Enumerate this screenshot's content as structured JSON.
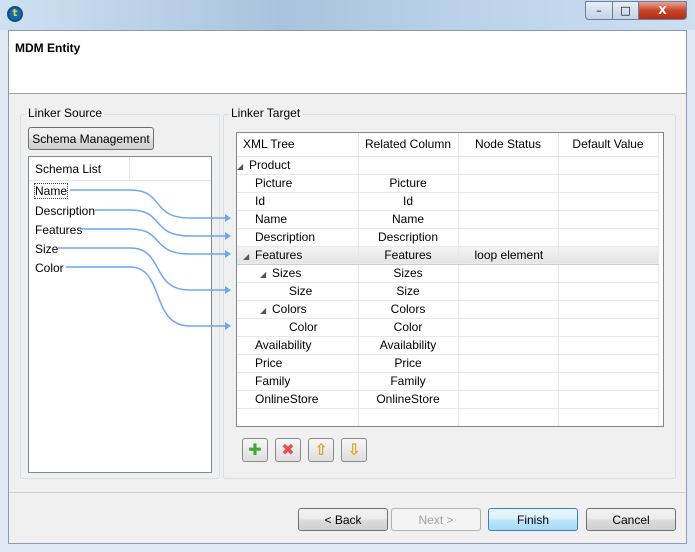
{
  "window": {
    "title": "MDM Entity",
    "controls": {
      "minimize": "–",
      "maximize": "□",
      "close": "X"
    }
  },
  "source": {
    "group_label": "Linker Source",
    "schema_button": "Schema Management",
    "list_header": "Schema List",
    "items": [
      "Name",
      "Description",
      "Features",
      "Size",
      "Color"
    ]
  },
  "target": {
    "group_label": "Linker Target",
    "columns": [
      "XML Tree",
      "Related Column",
      "Node Status",
      "Default Value"
    ],
    "rows": [
      {
        "tree": "Product",
        "related": "",
        "status": "",
        "default": ""
      },
      {
        "tree": "Picture",
        "related": "Picture",
        "status": "",
        "default": ""
      },
      {
        "tree": "Id",
        "related": "Id",
        "status": "",
        "default": ""
      },
      {
        "tree": "Name",
        "related": "Name",
        "status": "",
        "default": ""
      },
      {
        "tree": "Description",
        "related": "Description",
        "status": "",
        "default": ""
      },
      {
        "tree": "Features",
        "related": "Features",
        "status": "loop element",
        "default": ""
      },
      {
        "tree": "Sizes",
        "related": "Sizes",
        "status": "",
        "default": ""
      },
      {
        "tree": "Size",
        "related": "Size",
        "status": "",
        "default": ""
      },
      {
        "tree": "Colors",
        "related": "Colors",
        "status": "",
        "default": ""
      },
      {
        "tree": "Color",
        "related": "Color",
        "status": "",
        "default": ""
      },
      {
        "tree": "Availability",
        "related": "Availability",
        "status": "",
        "default": ""
      },
      {
        "tree": "Price",
        "related": "Price",
        "status": "",
        "default": ""
      },
      {
        "tree": "Family",
        "related": "Family",
        "status": "",
        "default": ""
      },
      {
        "tree": "OnlineStore",
        "related": "OnlineStore",
        "status": "",
        "default": ""
      }
    ],
    "toolbar": [
      "add-icon",
      "delete-icon",
      "move-up-icon",
      "move-down-icon"
    ]
  },
  "footer": {
    "back": "< Back",
    "next": "Next >",
    "finish": "Finish",
    "cancel": "Cancel"
  },
  "colors": {
    "link_line": "#6ea6f6"
  }
}
